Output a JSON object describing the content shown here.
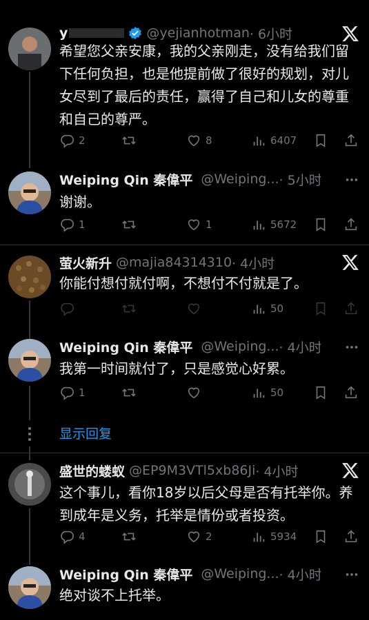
{
  "tweets": [
    {
      "name": "y",
      "handle": "@yejianhotman",
      "time": "· 6小时",
      "verified": true,
      "body": "希望您父亲安康，我的父亲刚走，没有给我们留下任何负担，也是他提前做了很好的规划，对儿女尽到了最后的责任，赢得了自己和儿女的尊重和自己的尊严。",
      "replies": "2",
      "retweets": "",
      "likes": "8",
      "views": "6407"
    },
    {
      "name": "Weiping Qin 秦偉平",
      "handle": "@Weiping...",
      "time": "· 5小时",
      "verified": true,
      "body": "谢谢。",
      "replies": "1",
      "retweets": "",
      "likes": "1",
      "views": "5672"
    },
    {
      "name": "萤火新升",
      "handle": "@majia84314310",
      "time": "· 4小时",
      "verified": false,
      "body": "你能付想付就付啊，不想付不付就是了。",
      "replies": "",
      "retweets": "",
      "likes": "",
      "views": "50"
    },
    {
      "name": "Weiping Qin 秦偉平",
      "handle": "@Weiping...",
      "time": "· 4小时",
      "verified": true,
      "body": "我第一时间就付了，只是感觉心好累。",
      "replies": "1",
      "retweets": "",
      "likes": "",
      "views": "50"
    },
    {
      "name": "盛世的蝼蚁",
      "handle": "@EP9M3VTl5xb86Ji",
      "time": "· 4小时",
      "verified": false,
      "body": "这个事儿，看你18岁以后父母是否有托举你。养到成年是义务，托举是情份或者投资。",
      "replies": "4",
      "retweets": "",
      "likes": "2",
      "views": "5934"
    },
    {
      "name": "Weiping Qin 秦偉平",
      "handle": "@Weiping...",
      "time": "· 4小时",
      "verified": true,
      "body": "绝对谈不上托举。"
    }
  ],
  "show_replies": "显示回复",
  "colors": {
    "accent": "#1d9bf0",
    "muted": "#71767b",
    "background": "#000000",
    "text": "#e7e9ea"
  },
  "icons": [
    "reply-icon",
    "retweet-icon",
    "like-icon",
    "views-icon",
    "bookmark-icon",
    "share-icon",
    "x-logo-icon",
    "more-icon",
    "verified-icon"
  ]
}
